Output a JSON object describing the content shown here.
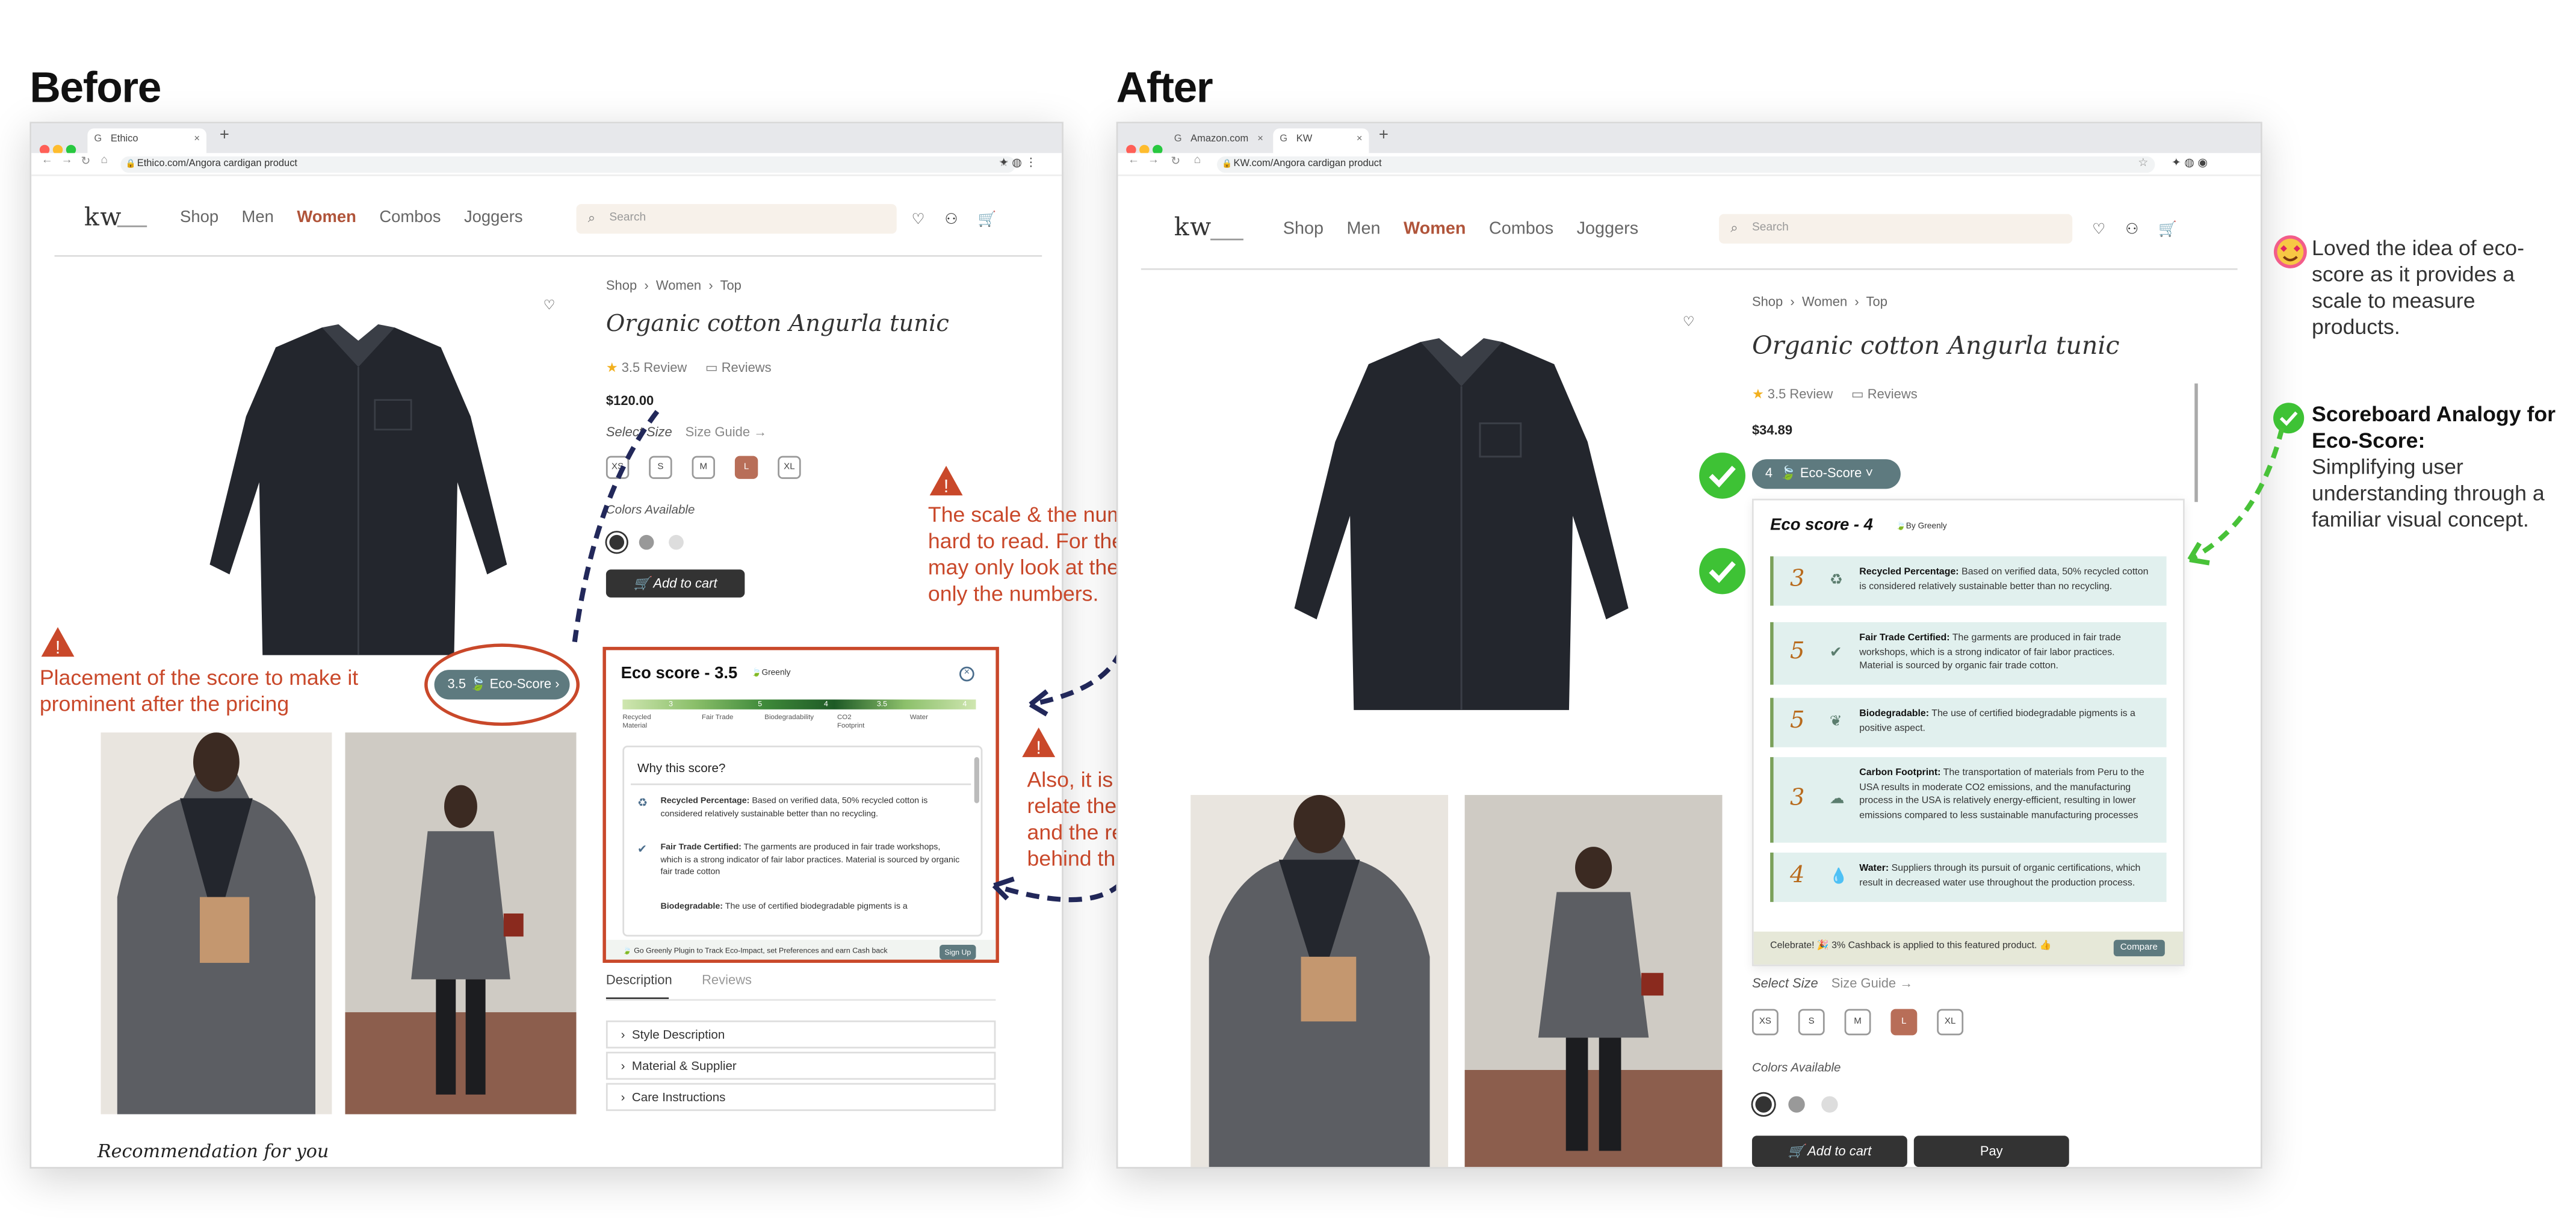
{
  "headings": {
    "before": "Before",
    "after": "After"
  },
  "before": {
    "tab_title": "Ethico",
    "url": "Ethico.com/Angora cardigan product",
    "logo": "kw",
    "nav": [
      "Shop",
      "Men",
      "Women",
      "Combos",
      "Joggers"
    ],
    "nav_active": "Women",
    "search_placeholder": "Search",
    "breadcrumb": [
      "Shop",
      "Women",
      "Top"
    ],
    "product_title": "Organic cotton Angurla tunic",
    "rating": "3.5 Review",
    "reviews_label": "Reviews",
    "price": "$120.00",
    "select_size": "Select Size",
    "size_guide": "Size Guide",
    "sizes": [
      "XS",
      "S",
      "M",
      "L",
      "XL"
    ],
    "selected_size": "L",
    "colors_label": "Colors Available",
    "add_to_cart": "Add to cart",
    "eco_btn": {
      "score": "3.5",
      "label": "Eco-Score"
    },
    "eco_panel": {
      "title": "Eco score - 3.5",
      "brand": "Greenly",
      "bar_values": [
        "3",
        "5",
        "4",
        "3.5",
        "4"
      ],
      "bar_labels": [
        "Recycled Material",
        "Fair Trade",
        "Biodegradability",
        "CO2 Footprint",
        "Water"
      ],
      "why_title": "Why this score?",
      "reasons": [
        {
          "label": "Recycled Percentage:",
          "text": "Based on verified data, 50% recycled cotton is considered relatively sustainable better than no recycling."
        },
        {
          "label": "Fair Trade Certified:",
          "text": "The garments are produced in fair trade workshops, which is a strong indicator of fair labor practices. Material is sourced by organic fair trade cotton"
        },
        {
          "label": "Biodegradable:",
          "text": "The use of certified biodegradable pigments is a"
        }
      ],
      "footer_text": "Go Greenly Plugin to Track Eco-Impact, set Preferences and earn Cash back",
      "footer_btn": "Sign Up"
    },
    "desc_tabs": [
      "Description",
      "Reviews"
    ],
    "accordion": [
      "Style  Description",
      "Material & Supplier",
      "Care Instructions"
    ],
    "recommendation": "Recommendation for you",
    "annotations": {
      "placement": "Placement of the score to make it prominent after the pricing",
      "scale": "The scale & the number are hard to read. For the score, I may only look at the scale but only the numbers.",
      "relate": "Also, it is hard to relate the numbers and the reasoning behind the score."
    }
  },
  "after": {
    "tabs": [
      "Amazon.com",
      "KW"
    ],
    "url": "KW.com/Angora cardigan product",
    "logo": "kw",
    "nav": [
      "Shop",
      "Men",
      "Women",
      "Combos",
      "Joggers"
    ],
    "nav_active": "Women",
    "search_placeholder": "Search",
    "breadcrumb": [
      "Shop",
      "Women",
      "Top"
    ],
    "product_title": "Organic cotton Angurla tunic",
    "rating": "3.5 Review",
    "reviews_label": "Reviews",
    "price": "$34.89",
    "eco_btn": {
      "score": "4",
      "label": "Eco-Score"
    },
    "eco_panel": {
      "title": "Eco score - 4",
      "by": "By Greenly",
      "cards": [
        {
          "num": "3",
          "label": "Recycled Percentage:",
          "text": "Based on verified data, 50% recycled cotton is considered relatively sustainable better than no recycling."
        },
        {
          "num": "5",
          "label": "Fair Trade Certified:",
          "text": "The garments are produced in fair trade workshops, which is a strong indicator of fair labor practices. Material is sourced by organic fair trade cotton."
        },
        {
          "num": "5",
          "label": "Biodegradable:",
          "text": "The use of certified biodegradable pigments is a positive aspect."
        },
        {
          "num": "3",
          "label": "Carbon Footprint:",
          "text": "The transportation of materials from Peru to the USA results in moderate CO2 emissions, and the manufacturing process in the USA is relatively energy-efficient, resulting in lower emissions compared to less sustainable manufacturing processes"
        },
        {
          "num": "4",
          "label": "Water:",
          "text": "Suppliers through its pursuit of organic certifications, which result in decreased water use throughout the production process."
        }
      ],
      "footer_text": "Celebrate! 🎉 3% Cashback is applied to this featured product. 👍",
      "footer_btn": "Compare"
    },
    "select_size": "Select Size",
    "size_guide": "Size Guide",
    "sizes": [
      "XS",
      "S",
      "M",
      "L",
      "XL"
    ],
    "selected_size": "L",
    "colors_label": "Colors Available",
    "add_to_cart": "Add to cart",
    "pay": "Pay",
    "notes": {
      "loved": "Loved the idea of eco-score as it provides a scale to measure products.",
      "analogy_title": "Scoreboard Analogy for Eco-Score:",
      "analogy_text": "Simplifying user understanding through a familiar visual concept."
    }
  },
  "colors": {
    "accent_red": "#c9482a",
    "eco_teal": "#5e7a7f",
    "active_nav": "#b0543a",
    "check_green": "#3ec235"
  }
}
